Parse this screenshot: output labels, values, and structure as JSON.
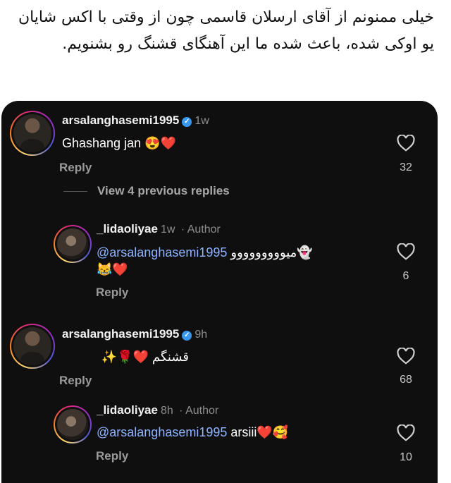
{
  "caption": "خیلی ممنونم از آقای ارسلان قاسمی چون از وقتی با اکس شایان یو اوکی شده، باعث شده ما این آهنگای قشنگ رو بشنویم.",
  "comments": [
    {
      "username": "arsalanghasemi1995",
      "time": "1w",
      "text": "Ghashang jan",
      "emoji": "😍❤️",
      "reply_label": "Reply",
      "likes": "32"
    },
    {
      "username": "arsalanghasemi1995",
      "time": "9h",
      "text": "قشنگم",
      "emoji": "❤️🌹✨",
      "reply_label": "Reply",
      "likes": "68"
    }
  ],
  "view_previous": "View 4 previous replies",
  "replies": [
    {
      "username": "_lidaoliyae",
      "time": "1w",
      "author_tag": "Author",
      "mention": "@arsalanghasemi1995",
      "text": "میووووووووو",
      "emoji_inline": "👻",
      "emoji_line2": "😹❤️",
      "reply_label": "Reply",
      "likes": "6"
    },
    {
      "username": "_lidaoliyae",
      "time": "8h",
      "author_tag": "Author",
      "mention": "@arsalanghasemi1995",
      "text": "arsiii",
      "emoji": "❤️🥰",
      "reply_label": "Reply",
      "likes": "10"
    }
  ],
  "icons": {
    "like": "heart-outline-icon",
    "verified": "verified-badge-icon"
  },
  "colors": {
    "card_bg": "#0f0f10",
    "mention": "#8fb3ff",
    "verified": "#3897f0"
  }
}
